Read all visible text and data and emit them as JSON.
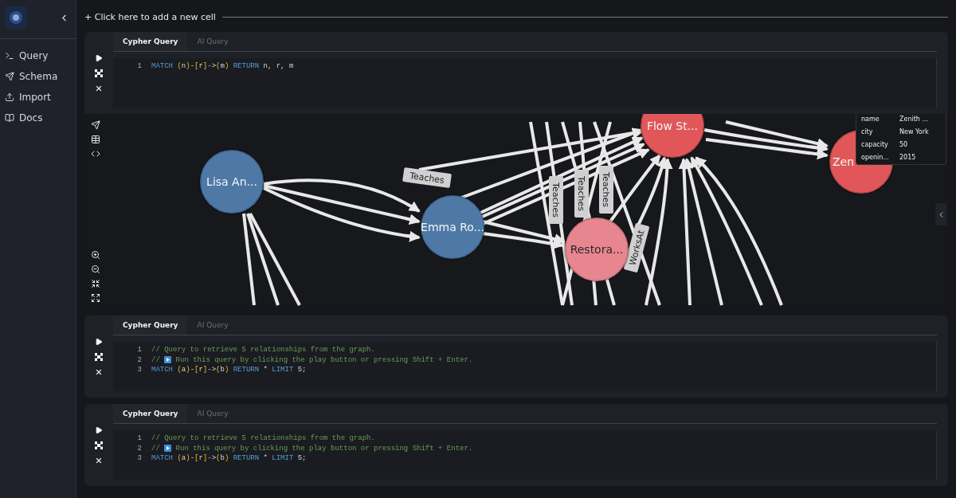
{
  "sidebar": {
    "items": [
      {
        "kind": "query",
        "label": "Query"
      },
      {
        "kind": "schema",
        "label": "Schema"
      },
      {
        "kind": "import",
        "label": "Import"
      },
      {
        "kind": "docs",
        "label": "Docs"
      }
    ]
  },
  "add_cell": "+ Click here to add a new cell",
  "cells": [
    {
      "tabs": [
        {
          "label": "Cypher Query",
          "selected": true
        },
        {
          "label": "AI Query",
          "selected": false
        }
      ],
      "lines": [
        {
          "number": "1",
          "tokens": [
            {
              "kind": "keyword",
              "text": "MATCH "
            },
            {
              "kind": "paren",
              "text": "("
            },
            {
              "kind": "plain",
              "text": "n"
            },
            {
              "kind": "paren",
              "text": ")"
            },
            {
              "kind": "plain",
              "text": "-"
            },
            {
              "kind": "paren",
              "text": "["
            },
            {
              "kind": "plain",
              "text": "r"
            },
            {
              "kind": "paren",
              "text": "]"
            },
            {
              "kind": "plain",
              "text": "->"
            },
            {
              "kind": "paren",
              "text": "("
            },
            {
              "kind": "plain",
              "text": "m"
            },
            {
              "kind": "paren",
              "text": ")"
            },
            {
              "kind": "keyword",
              "text": " RETURN "
            },
            {
              "kind": "plain",
              "text": "n, r, m"
            }
          ]
        }
      ],
      "graph": {
        "nodes": [
          {
            "label": "Lisa An...",
            "color": "#4e79a7"
          },
          {
            "label": "Emma Ro...",
            "color": "#4e79a7"
          },
          {
            "label": "Restora...",
            "color": "#e8868f"
          },
          {
            "label": "Flow St...",
            "color": "#e15759"
          },
          {
            "label": "Zen",
            "color": "#e15759"
          }
        ],
        "edge_labels": [
          "Teaches",
          "Teaches",
          "Teaches",
          "Teaches",
          "WorksAt"
        ],
        "tooltip": [
          {
            "key": "name",
            "value": "Zenith ..."
          },
          {
            "key": "city",
            "value": "New York"
          },
          {
            "key": "capacity",
            "value": "50"
          },
          {
            "key": "openin...",
            "value": "2015"
          }
        ]
      }
    },
    {
      "tabs": [
        {
          "label": "Cypher Query",
          "selected": true
        },
        {
          "label": "AI Query",
          "selected": false
        }
      ],
      "lines": [
        {
          "number": "1",
          "tokens": [
            {
              "kind": "comment",
              "text": "// Query to retrieve 5 relationships from the graph."
            }
          ]
        },
        {
          "number": "2",
          "tokens": [
            {
              "kind": "comment",
              "text": "// "
            },
            {
              "kind": "play_emoji"
            },
            {
              "kind": "comment",
              "text": " Run this query by clicking the play button or pressing Shift + Enter."
            }
          ]
        },
        {
          "number": "3",
          "tokens": [
            {
              "kind": "keyword",
              "text": "MATCH "
            },
            {
              "kind": "paren",
              "text": "("
            },
            {
              "kind": "plain",
              "text": "a"
            },
            {
              "kind": "paren",
              "text": ")"
            },
            {
              "kind": "plain",
              "text": "-"
            },
            {
              "kind": "paren",
              "text": "["
            },
            {
              "kind": "plain",
              "text": "r"
            },
            {
              "kind": "paren",
              "text": "]"
            },
            {
              "kind": "plain",
              "text": "->"
            },
            {
              "kind": "paren",
              "text": "("
            },
            {
              "kind": "plain",
              "text": "b"
            },
            {
              "kind": "paren",
              "text": ")"
            },
            {
              "kind": "keyword",
              "text": " RETURN "
            },
            {
              "kind": "plain",
              "text": "* "
            },
            {
              "kind": "keyword",
              "text": "LIMIT "
            },
            {
              "kind": "plain",
              "text": "5;"
            }
          ]
        }
      ]
    },
    {
      "tabs": [
        {
          "label": "Cypher Query",
          "selected": true
        },
        {
          "label": "AI Query",
          "selected": false
        }
      ],
      "lines": [
        {
          "number": "1",
          "tokens": [
            {
              "kind": "comment",
              "text": "// Query to retrieve 5 relationships from the graph."
            }
          ]
        },
        {
          "number": "2",
          "tokens": [
            {
              "kind": "comment",
              "text": "// "
            },
            {
              "kind": "play_emoji"
            },
            {
              "kind": "comment",
              "text": " Run this query by clicking the play button or pressing Shift + Enter."
            }
          ]
        },
        {
          "number": "3",
          "tokens": [
            {
              "kind": "keyword",
              "text": "MATCH "
            },
            {
              "kind": "paren",
              "text": "("
            },
            {
              "kind": "plain",
              "text": "a"
            },
            {
              "kind": "paren",
              "text": ")"
            },
            {
              "kind": "plain",
              "text": "-"
            },
            {
              "kind": "paren",
              "text": "["
            },
            {
              "kind": "plain",
              "text": "r"
            },
            {
              "kind": "paren",
              "text": "]"
            },
            {
              "kind": "plain",
              "text": "->"
            },
            {
              "kind": "paren",
              "text": "("
            },
            {
              "kind": "plain",
              "text": "b"
            },
            {
              "kind": "paren",
              "text": ")"
            },
            {
              "kind": "keyword",
              "text": " RETURN "
            },
            {
              "kind": "plain",
              "text": "* "
            },
            {
              "kind": "keyword",
              "text": "LIMIT "
            },
            {
              "kind": "plain",
              "text": "5;"
            }
          ]
        }
      ]
    }
  ]
}
